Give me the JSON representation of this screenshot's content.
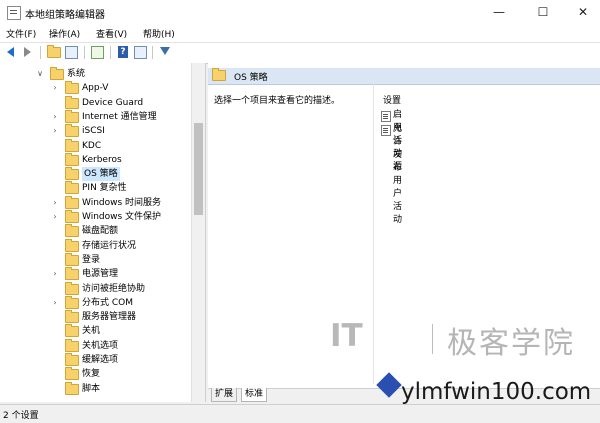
{
  "window": {
    "title": "本地组策略编辑器",
    "min": "—",
    "max": "☐",
    "close": "✕"
  },
  "menu": [
    "文件(F)",
    "操作(A)",
    "查看(V)",
    "帮助(H)"
  ],
  "tree": [
    {
      "label": "系统",
      "expander": "v",
      "selected": false
    },
    {
      "label": "App-V",
      "expander": ">",
      "selected": false
    },
    {
      "label": "Device Guard",
      "expander": "",
      "selected": false
    },
    {
      "label": "Internet 通信管理",
      "expander": ">",
      "selected": false
    },
    {
      "label": "iSCSI",
      "expander": ">",
      "selected": false
    },
    {
      "label": "KDC",
      "expander": "",
      "selected": false
    },
    {
      "label": "Kerberos",
      "expander": "",
      "selected": false
    },
    {
      "label": "OS 策略",
      "expander": "",
      "selected": true
    },
    {
      "label": "PIN 复杂性",
      "expander": "",
      "selected": false
    },
    {
      "label": "Windows 时间服务",
      "expander": ">",
      "selected": false
    },
    {
      "label": "Windows 文件保护",
      "expander": ">",
      "selected": false
    },
    {
      "label": "磁盘配额",
      "expander": "",
      "selected": false
    },
    {
      "label": "存储运行状况",
      "expander": "",
      "selected": false
    },
    {
      "label": "登录",
      "expander": "",
      "selected": false
    },
    {
      "label": "电源管理",
      "expander": ">",
      "selected": false
    },
    {
      "label": "访问被拒绝协助",
      "expander": "",
      "selected": false
    },
    {
      "label": "分布式 COM",
      "expander": ">",
      "selected": false
    },
    {
      "label": "服务器管理器",
      "expander": "",
      "selected": false
    },
    {
      "label": "关机",
      "expander": "",
      "selected": false
    },
    {
      "label": "关机选项",
      "expander": "",
      "selected": false
    },
    {
      "label": "缓解选项",
      "expander": "",
      "selected": false
    },
    {
      "label": "恢复",
      "expander": "",
      "selected": false
    },
    {
      "label": "脚本",
      "expander": "",
      "selected": false
    }
  ],
  "right": {
    "header_title": "OS 策略",
    "description": "选择一个项目来查看它的描述。",
    "settings_header": "设置",
    "settings": [
      "启用活动源",
      "允许发布用户活动"
    ]
  },
  "tabs": [
    "扩展",
    "标准"
  ],
  "status": "2 个设置",
  "watermark": {
    "it": "IT",
    "cn": "极客学院",
    "site": "ylmfwin100.com"
  }
}
